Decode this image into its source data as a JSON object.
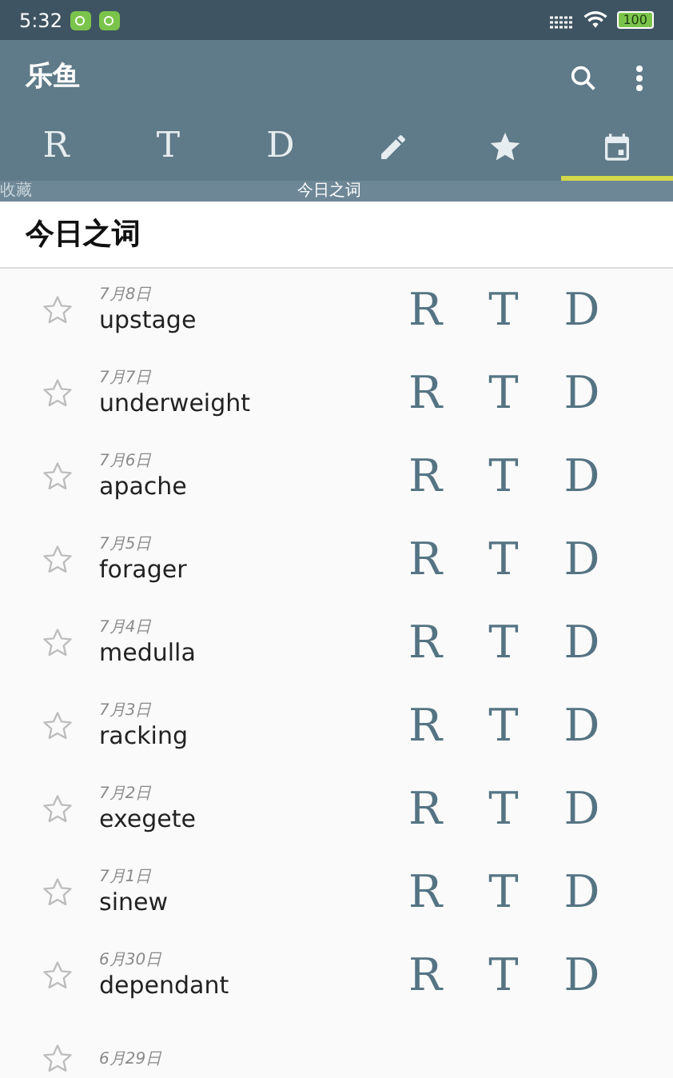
{
  "status_bar": {
    "time": "5:32",
    "battery": "100"
  },
  "app_bar": {
    "title": "乐鱼"
  },
  "tabs": [
    {
      "kind": "letter",
      "label": "R",
      "selected": false
    },
    {
      "kind": "letter",
      "label": "T",
      "selected": false
    },
    {
      "kind": "letter",
      "label": "D",
      "selected": false
    },
    {
      "kind": "pencil",
      "selected": false
    },
    {
      "kind": "star",
      "selected": false
    },
    {
      "kind": "calendar",
      "selected": true
    }
  ],
  "tab_captions": [
    "收藏",
    "今日之词"
  ],
  "page_title": "今日之词",
  "words": [
    {
      "date": "7月8日",
      "word": "upstage",
      "starred": false,
      "buttons": [
        "R",
        "T",
        "D"
      ]
    },
    {
      "date": "7月7日",
      "word": "underweight",
      "starred": false,
      "buttons": [
        "R",
        "T",
        "D"
      ]
    },
    {
      "date": "7月6日",
      "word": "apache",
      "starred": false,
      "buttons": [
        "R",
        "T",
        "D"
      ]
    },
    {
      "date": "7月5日",
      "word": "forager",
      "starred": false,
      "buttons": [
        "R",
        "T",
        "D"
      ]
    },
    {
      "date": "7月4日",
      "word": "medulla",
      "starred": false,
      "buttons": [
        "R",
        "T",
        "D"
      ]
    },
    {
      "date": "7月3日",
      "word": "racking",
      "starred": false,
      "buttons": [
        "R",
        "T",
        "D"
      ]
    },
    {
      "date": "7月2日",
      "word": "exegete",
      "starred": false,
      "buttons": [
        "R",
        "T",
        "D"
      ]
    },
    {
      "date": "7月1日",
      "word": "sinew",
      "starred": false,
      "buttons": [
        "R",
        "T",
        "D"
      ]
    },
    {
      "date": "6月30日",
      "word": "dependant",
      "starred": false,
      "buttons": [
        "R",
        "T",
        "D"
      ]
    },
    {
      "date": "6月29日",
      "starred": false
    }
  ]
}
